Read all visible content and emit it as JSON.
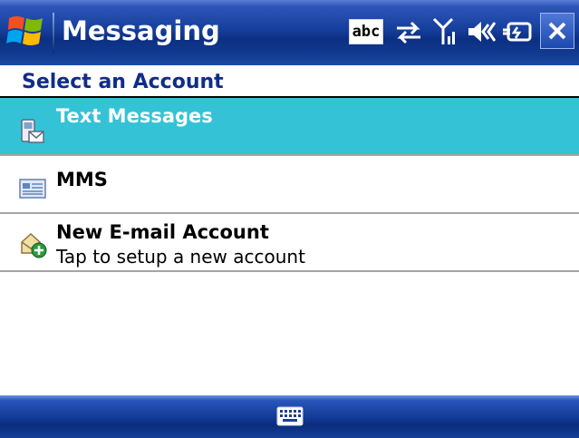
{
  "titlebar": {
    "app_title": "Messaging",
    "start_icon": "windows-flag-icon",
    "status_icons": [
      "abc-input-icon",
      "connectivity-icon",
      "signal-icon",
      "volume-icon",
      "battery-icon"
    ],
    "abc_label": "abc",
    "close_icon": "close-icon"
  },
  "header": {
    "title": "Select an Account"
  },
  "accounts": [
    {
      "icon": "text-message-icon",
      "title": "Text Messages",
      "subtitle": ""
    },
    {
      "icon": "mms-icon",
      "title": "MMS",
      "subtitle": ""
    },
    {
      "icon": "new-email-icon",
      "title": "New E-mail Account",
      "subtitle": "Tap to setup a new account"
    }
  ],
  "bottombar": {
    "icon": "keyboard-icon"
  },
  "colors": {
    "titlebar": "#163f9c",
    "selected_row": "#34c3d6",
    "header_text": "#102d8a",
    "divider": "#a4a4a4"
  }
}
